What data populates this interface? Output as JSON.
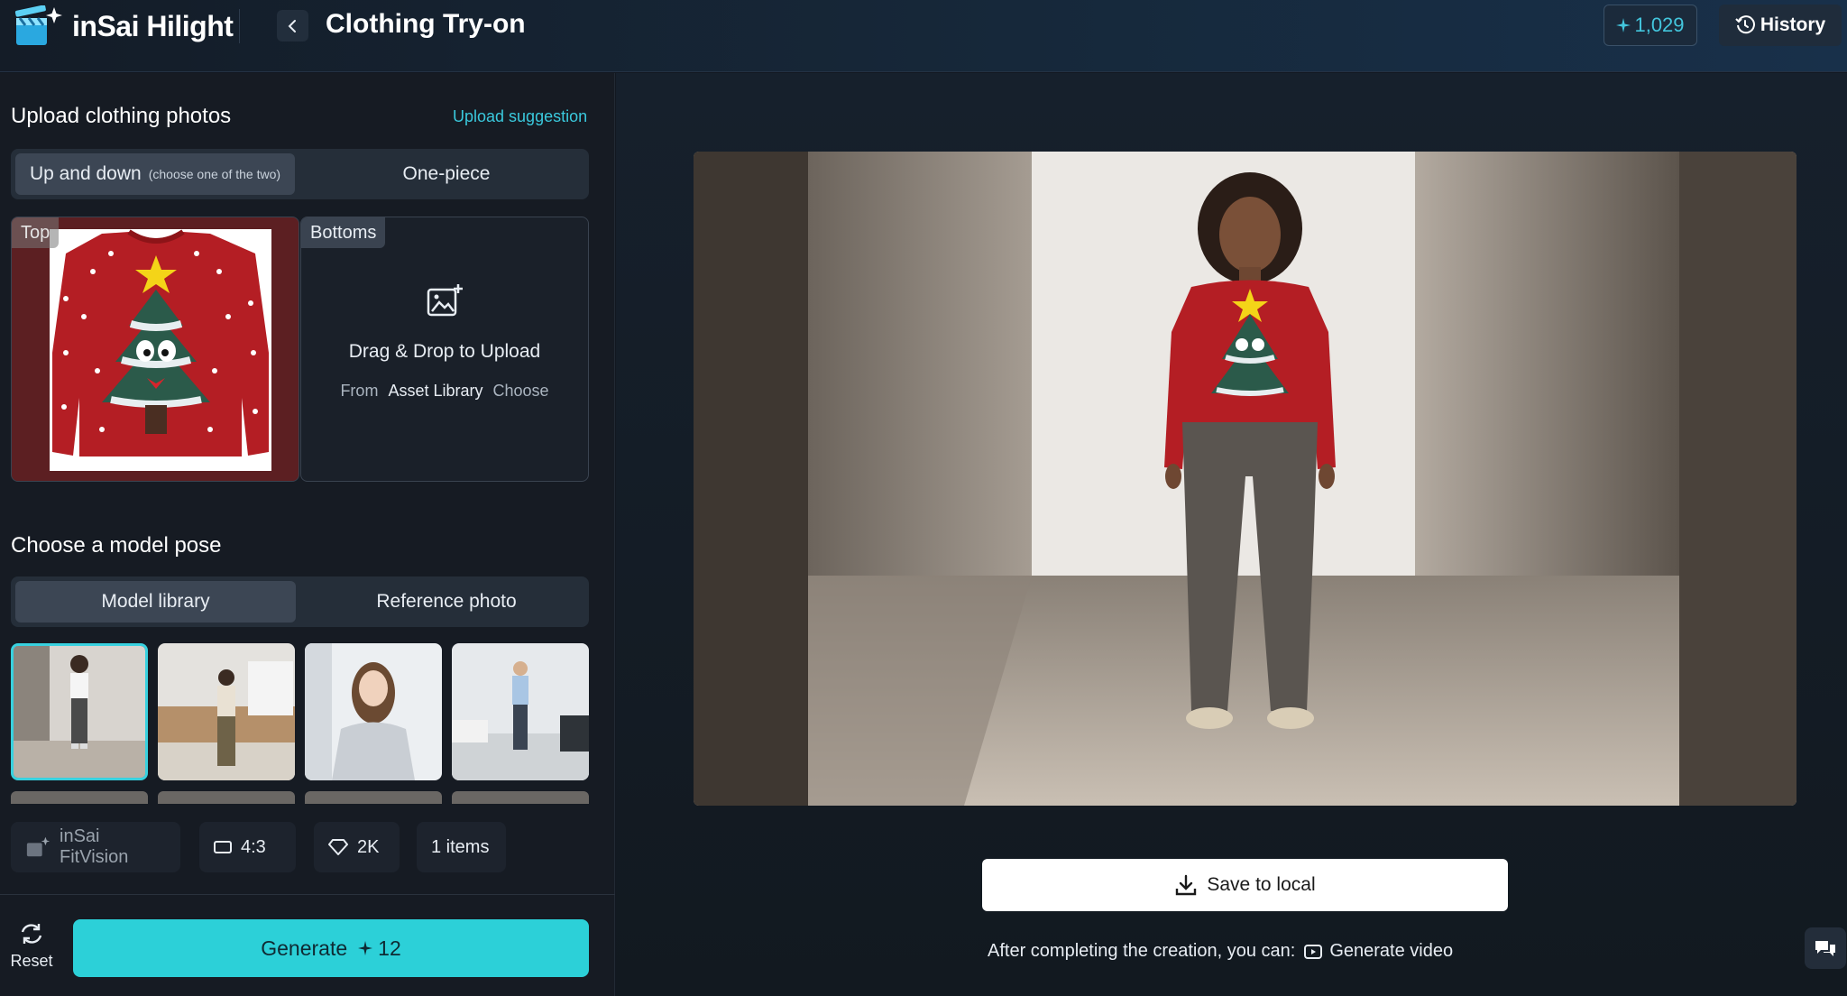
{
  "header": {
    "brand": "inSai Hilight",
    "title": "Clothing Try-on",
    "credits": "1,029",
    "history_label": "History"
  },
  "upload": {
    "title": "Upload clothing photos",
    "suggestion_link": "Upload suggestion",
    "tabs": {
      "up_down": "Up and down",
      "up_down_hint": "(choose one of the two)",
      "one_piece": "One-piece"
    },
    "top_label": "Top",
    "bottoms_label": "Bottoms",
    "drag_drop": "Drag & Drop to Upload",
    "from": "From",
    "asset_library": "Asset Library",
    "choose": "Choose"
  },
  "pose": {
    "title": "Choose a model pose",
    "tabs": {
      "model_library": "Model library",
      "reference_photo": "Reference photo"
    },
    "selected_index": 0
  },
  "options": {
    "model": "inSai FitVision",
    "ratio": "4:3",
    "resolution": "2K",
    "items": "1 items"
  },
  "actions": {
    "reset": "Reset",
    "generate": "Generate",
    "generate_cost": "12",
    "save": "Save to local",
    "after_text": "After completing the creation, you can:",
    "generate_video": "Generate video"
  },
  "colors": {
    "accent": "#2cd0d8",
    "credit_text": "#43c6dd",
    "link": "#3ac9dd",
    "sweater_red": "#b41e24"
  }
}
